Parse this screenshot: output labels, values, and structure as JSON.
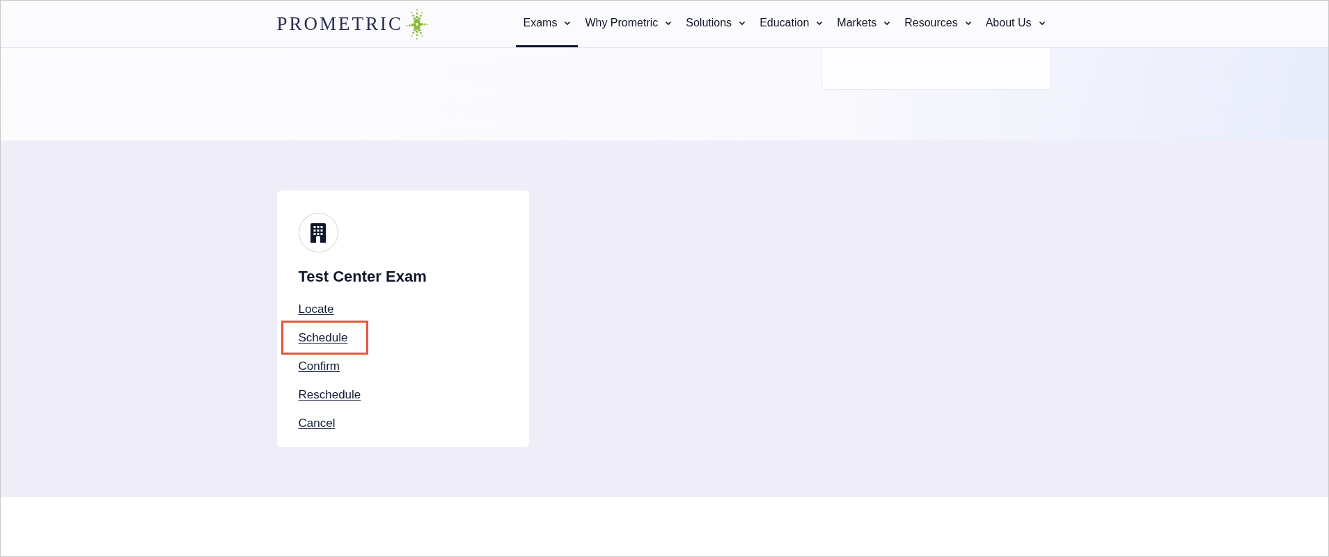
{
  "header": {
    "logo": "PROMETRIC",
    "nav": [
      {
        "label": "Exams",
        "selected": true
      },
      {
        "label": "Why Prometric",
        "selected": false
      },
      {
        "label": "Solutions",
        "selected": false
      },
      {
        "label": "Education",
        "selected": false
      },
      {
        "label": "Markets",
        "selected": false
      },
      {
        "label": "Resources",
        "selected": false
      },
      {
        "label": "About Us",
        "selected": false
      }
    ]
  },
  "card": {
    "title": "Test Center Exam",
    "links": [
      {
        "label": "Locate",
        "highlighted": false
      },
      {
        "label": "Schedule",
        "highlighted": true
      },
      {
        "label": "Confirm",
        "highlighted": false
      },
      {
        "label": "Reschedule",
        "highlighted": false
      },
      {
        "label": "Cancel",
        "highlighted": false
      }
    ]
  }
}
